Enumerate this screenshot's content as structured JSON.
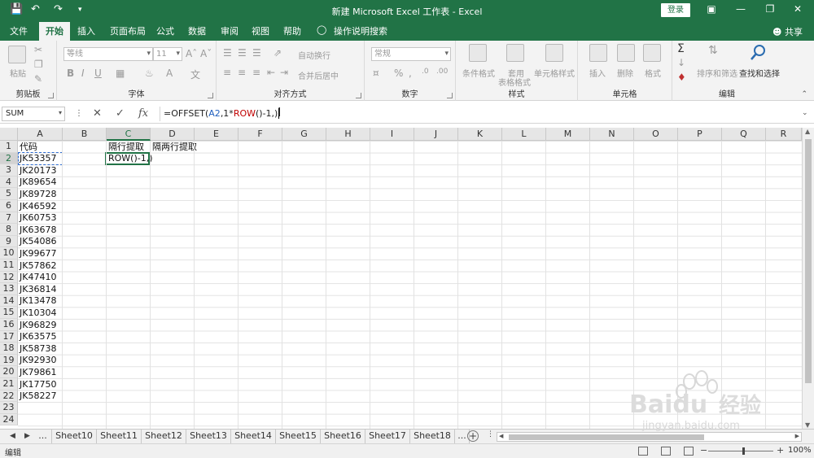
{
  "titlebar": {
    "title": "新建 Microsoft Excel 工作表 - Excel",
    "login": "登录",
    "save_icon": "save-icon",
    "undo_icon": "undo-icon",
    "redo_icon": "redo-icon"
  },
  "tabs": [
    {
      "label": "文件"
    },
    {
      "label": "开始"
    },
    {
      "label": "插入"
    },
    {
      "label": "页面布局"
    },
    {
      "label": "公式"
    },
    {
      "label": "数据"
    },
    {
      "label": "审阅"
    },
    {
      "label": "视图"
    },
    {
      "label": "帮助"
    },
    {
      "label": "操作说明搜索"
    }
  ],
  "share": "共享",
  "ribbon": {
    "clipboard": {
      "label": "剪贴板",
      "paste": "粘贴"
    },
    "font": {
      "label": "字体",
      "font_name": "等线",
      "font_size": "11"
    },
    "alignment": {
      "label": "对齐方式",
      "wrap": "自动换行",
      "merge": "合并后居中"
    },
    "number": {
      "label": "数字",
      "format": "常规"
    },
    "styles": {
      "label": "样式",
      "cond_format": "条件格式",
      "table_format_1": "套用",
      "table_format_2": "表格格式",
      "cell_styles": "单元格样式"
    },
    "cells": {
      "label": "单元格",
      "insert": "插入",
      "delete": "删除",
      "format": "格式"
    },
    "editing": {
      "label": "编辑",
      "sort_filter": "排序和筛选",
      "find_select": "查找和选择"
    }
  },
  "formula_bar": {
    "name_box": "SUM",
    "formula_parts": [
      "=OFFSET(",
      "A2",
      ",1*",
      "ROW",
      "()-1,)"
    ]
  },
  "columns": [
    "A",
    "B",
    "C",
    "D",
    "E",
    "F",
    "G",
    "H",
    "I",
    "J",
    "K",
    "L",
    "M",
    "N",
    "O",
    "P",
    "Q",
    "R"
  ],
  "rows": [
    "1",
    "2",
    "3",
    "4",
    "5",
    "6",
    "7",
    "8",
    "9",
    "10",
    "11",
    "12",
    "13",
    "14",
    "15",
    "16",
    "17",
    "18",
    "19",
    "20",
    "21",
    "22",
    "23",
    "24"
  ],
  "cells": {
    "A": [
      "代码",
      "JK53357",
      "JK20173",
      "JK89654",
      "JK89728",
      "JK46592",
      "JK60753",
      "JK63678",
      "JK54086",
      "JK99677",
      "JK57862",
      "JK47410",
      "JK36814",
      "JK13478",
      "JK10304",
      "JK96829",
      "JK63575",
      "JK58738",
      "JK92930",
      "JK79861",
      "JK17750",
      "JK58227"
    ],
    "C1": "隔行提取",
    "C2": "ROW()-1,)",
    "D1": "隔两行提取"
  },
  "sheets": [
    "...",
    "Sheet10",
    "Sheet11",
    "Sheet12",
    "Sheet13",
    "Sheet14",
    "Sheet15",
    "Sheet16",
    "Sheet17",
    "Sheet18",
    "..."
  ],
  "status": {
    "mode": "编辑",
    "zoom": "100%"
  },
  "watermark": {
    "brand": "Baidu",
    "brand_cn": "经验",
    "url": "jingyan.baidu.com"
  },
  "colors": {
    "accent": "#217346",
    "ref_blue": "#1f5fbf",
    "func_red": "#c00000"
  }
}
